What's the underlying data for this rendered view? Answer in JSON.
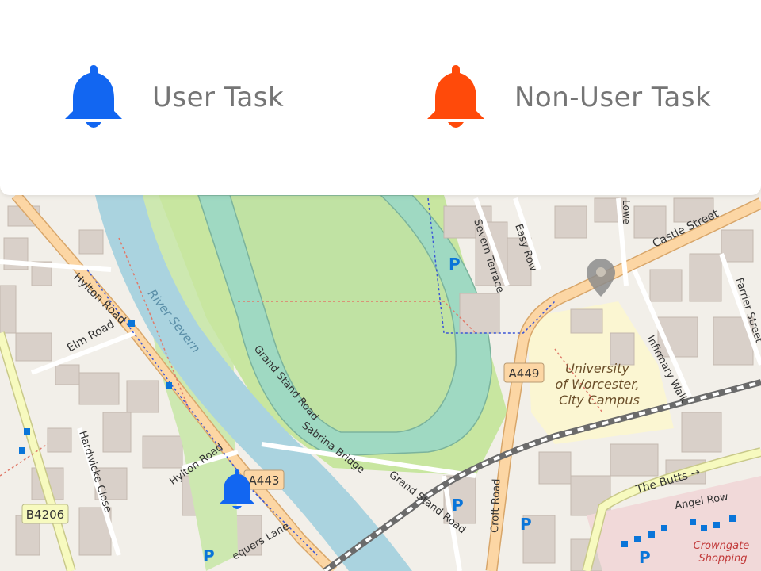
{
  "legend": {
    "items": [
      {
        "label": "User Task",
        "icon": "bell-icon",
        "color": "#1266f1"
      },
      {
        "label": "Non-User Task",
        "icon": "bell-icon",
        "color": "#ff4a0a"
      }
    ]
  },
  "map": {
    "labels": {
      "hylton_road": "Hylton Road",
      "hylton_road_2": "Hylton Road",
      "river_severn": "River Severn",
      "elm_road": "Elm Road",
      "grand_stand_road": "Grand Stand Road",
      "grand_stand_road_2": "Grand Stand Road",
      "sabrina_bridge": "Sabrina Bridge",
      "hardwicke_close": "Hardwicke Close",
      "severn_terrace": "Severn Terrace",
      "easy_row": "Easy Row",
      "castle_street": "Castle Street",
      "farrier_street": "Farrier Street",
      "infirmary_walk": "Infirmary Walk",
      "university": "University\nof Worcester,\nCity Campus",
      "croft_road": "Croft Road",
      "the_butts": "The Butts →",
      "angel_row": "Angel Row",
      "crowngate": "Crowngate\nShopping",
      "a449": "A449",
      "a443": "A443",
      "b4206": "B4206",
      "lowesmoor": "Lowe",
      "sequers_lane": "equers Lane"
    },
    "parking_symbol": "P",
    "colors": {
      "river": "#aad3df",
      "park": "#c8e6a0",
      "racecourse": "#bde3b0",
      "track": "#9fd9c2",
      "primary_road": "#fcd6a4",
      "secondary_road": "#f7fabf",
      "university": "#fbf6d2"
    },
    "markers": [
      {
        "type": "user-task",
        "icon": "bell-icon",
        "color": "#1266f1"
      },
      {
        "type": "location",
        "icon": "map-pin-icon",
        "color": "#8c8c8c"
      }
    ]
  }
}
